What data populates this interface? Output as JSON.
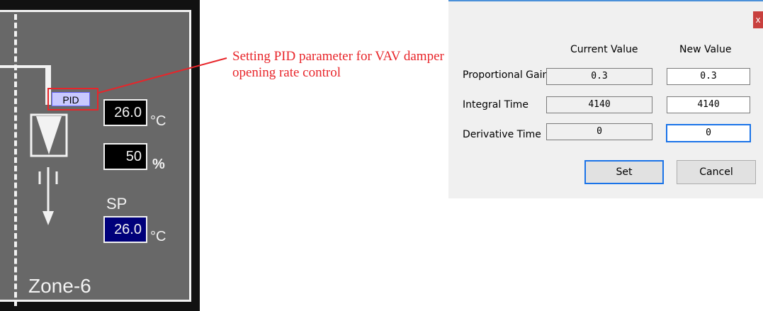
{
  "zone": {
    "pid_label": "PID",
    "temperature": "26.0",
    "temperature_unit": "°C",
    "damper_percent": "50",
    "percent_unit": "%",
    "sp_label": "SP",
    "setpoint": "26.0",
    "setpoint_unit": "°C",
    "name": "Zone-6"
  },
  "annotation": {
    "text": "Setting PID parameter for VAV damper opening rate control"
  },
  "dialog": {
    "close_label": "x",
    "headers": {
      "current": "Current Value",
      "new": "New Value"
    },
    "rows": [
      {
        "label": "Proportional Gain",
        "current": "0.3",
        "new": "0.3"
      },
      {
        "label": "Integral Time",
        "current": "4140",
        "new": "4140"
      },
      {
        "label": "Derivative Time",
        "current": "0",
        "new": "0"
      }
    ],
    "set_label": "Set",
    "cancel_label": "Cancel"
  },
  "colors": {
    "annotation": "#e8252a",
    "setpoint_bg": "#00007a",
    "focus": "#1a73e8"
  }
}
